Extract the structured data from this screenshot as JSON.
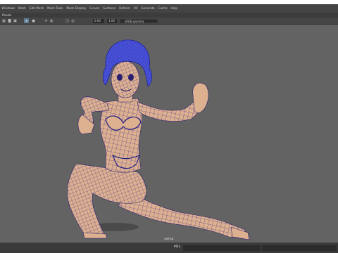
{
  "menu": [
    "Windows",
    "Mesh",
    "Edit Mesh",
    "Mesh Tools",
    "Mesh Display",
    "Curves",
    "Surfaces",
    "Deform",
    "UV",
    "Generate",
    "Cache",
    "Help"
  ],
  "panel_label": "Panels",
  "toolbar": {
    "field_a": "0.00",
    "field_b": "1.00",
    "colorspace": "sRGB gamma"
  },
  "viewport": {
    "camera_label": "persp"
  },
  "status": {
    "tab": "MEL"
  },
  "colors": {
    "mesh_fill": "#ddb190",
    "wire": "#1b2090",
    "viewport_bg": "#636363"
  },
  "icons": [
    "grid-icon",
    "camera-icon",
    "select-icon",
    "wireframe-icon",
    "shaded-icon",
    "lighting-icon",
    "shadow-icon",
    "isolate-icon",
    "xray-icon"
  ]
}
